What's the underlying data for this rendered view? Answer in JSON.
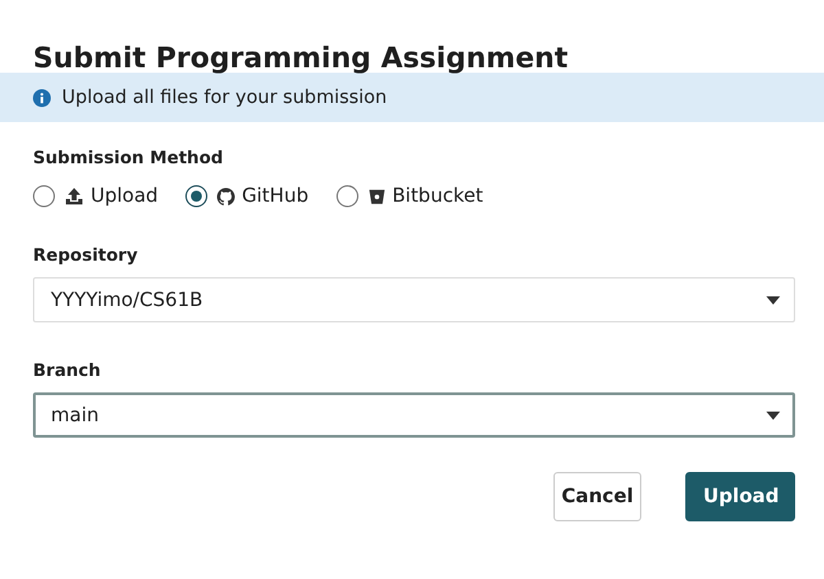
{
  "dialog": {
    "title": "Submit Programming Assignment"
  },
  "banner": {
    "text": "Upload all files for your submission"
  },
  "method": {
    "label": "Submission Method",
    "options": [
      {
        "label": "Upload",
        "kind": "upload",
        "selected": false
      },
      {
        "label": "GitHub",
        "kind": "github",
        "selected": true
      },
      {
        "label": "Bitbucket",
        "kind": "bitbucket",
        "selected": false
      }
    ]
  },
  "fields": [
    {
      "label": "Repository",
      "value": "YYYYimo/CS61B",
      "focused": false
    },
    {
      "label": "Branch",
      "value": "main",
      "focused": true
    }
  ],
  "buttons": [
    {
      "label": "Cancel",
      "kind": "secondary"
    },
    {
      "label": "Upload",
      "kind": "primary"
    }
  ]
}
